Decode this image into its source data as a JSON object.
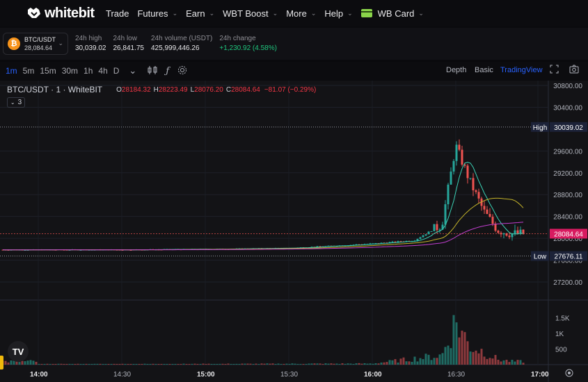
{
  "navbar": {
    "logo_text": "whitebit",
    "items": [
      {
        "label": "Trade"
      },
      {
        "label": "Futures"
      },
      {
        "label": "Earn"
      },
      {
        "label": "WBT Boost"
      },
      {
        "label": "More"
      },
      {
        "label": "Help"
      },
      {
        "label": "WB Card"
      }
    ]
  },
  "ticker": {
    "pair": "BTC/USDT",
    "price": "28,084.64",
    "high_label": "24h high",
    "high": "30,039.02",
    "low_label": "24h low",
    "low": "26,841.75",
    "volume_label": "24h volume (USDT)",
    "volume": "425,999,446.26",
    "change_label": "24h change",
    "change": "+1,230.92",
    "change_pct": "(4.58%)"
  },
  "toolbar": {
    "timeframes": [
      "1m",
      "5m",
      "15m",
      "30m",
      "1h",
      "4h",
      "D"
    ],
    "active_timeframe": "1m",
    "views": [
      "Depth",
      "Basic",
      "TradingView"
    ],
    "active_view": "TradingView"
  },
  "legend": {
    "symbol": "BTC/USDT · 1 · WhiteBIT",
    "o": "O",
    "o_val": "28184.32",
    "h": "H",
    "h_val": "28223.49",
    "l": "L",
    "l_val": "28076.20",
    "c": "C",
    "c_val": "28084.64",
    "change": "−81.07 (−0.29%)",
    "indicators_count": "3"
  },
  "price_axis": {
    "ticks": [
      "30800.00",
      "30400.00",
      "29600.00",
      "29200.00",
      "28800.00",
      "28400.00",
      "28000.00",
      "27600.00",
      "27200.00"
    ],
    "high_tag": "High",
    "high_val": "30039.02",
    "current_val": "28084.64",
    "low_tag": "Low",
    "low_val": "27676.11"
  },
  "volume_axis": {
    "ticks": [
      "1.5K",
      "1K",
      "500"
    ]
  },
  "time_axis": {
    "labels": [
      {
        "text": "14:00",
        "bold": true
      },
      {
        "text": "14:30",
        "bold": false
      },
      {
        "text": "15:00",
        "bold": true
      },
      {
        "text": "15:30",
        "bold": false
      },
      {
        "text": "16:00",
        "bold": true
      },
      {
        "text": "16:30",
        "bold": false
      },
      {
        "text": "17:00",
        "bold": true
      }
    ]
  },
  "colors": {
    "up": "#26a69a",
    "down": "#ef5350",
    "accent": "#2962ff",
    "ma_fast": "#3bd1b5",
    "ma_mid": "#c6b52a",
    "ma_slow": "#c23fd0"
  },
  "chart_data": {
    "type": "candlestick",
    "pair": "BTC/USDT",
    "interval": "1m",
    "y_range": [
      27000,
      30900
    ],
    "session_high": 30039.02,
    "session_low": 27676.11,
    "last_price": 28084.64,
    "series": [
      {
        "name": "price",
        "points": [
          {
            "t": "14:00",
            "v": 27790
          },
          {
            "t": "14:30",
            "v": 27790
          },
          {
            "t": "15:00",
            "v": 27800
          },
          {
            "t": "15:30",
            "v": 27820
          },
          {
            "t": "16:00",
            "v": 27900
          },
          {
            "t": "16:15",
            "v": 27960
          },
          {
            "t": "16:25",
            "v": 28250
          },
          {
            "t": "16:30",
            "v": 29700
          },
          {
            "t": "16:35",
            "v": 29050
          },
          {
            "t": "16:40",
            "v": 28500
          },
          {
            "t": "16:45",
            "v": 28150
          },
          {
            "t": "16:50",
            "v": 28084.64
          }
        ]
      },
      {
        "name": "volume",
        "points": [
          {
            "t": "14:00",
            "v": 20
          },
          {
            "t": "15:00",
            "v": 25
          },
          {
            "t": "16:00",
            "v": 40
          },
          {
            "t": "16:25",
            "v": 350
          },
          {
            "t": "16:30",
            "v": 1650
          },
          {
            "t": "16:35",
            "v": 700
          },
          {
            "t": "16:40",
            "v": 500
          },
          {
            "t": "16:45",
            "v": 200
          },
          {
            "t": "16:50",
            "v": 120
          }
        ]
      }
    ]
  }
}
